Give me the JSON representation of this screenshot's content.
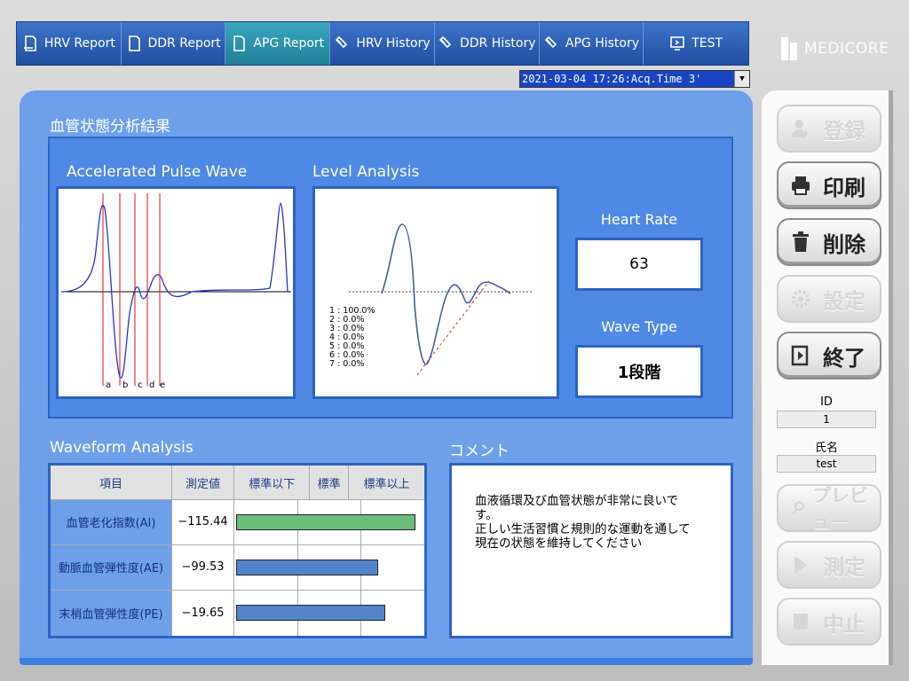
{
  "tabs": [
    {
      "label": "HRV Report",
      "icon": "report-icon"
    },
    {
      "label": "DDR Report",
      "icon": "report-icon"
    },
    {
      "label": "APG Report",
      "icon": "report-icon",
      "active": true
    },
    {
      "label": "HRV History",
      "icon": "history-icon"
    },
    {
      "label": "DDR History",
      "icon": "history-icon"
    },
    {
      "label": "APG History",
      "icon": "history-icon"
    },
    {
      "label": "TEST",
      "icon": "monitor-icon"
    }
  ],
  "brand": "MEDICORE",
  "record_select": {
    "value": "2021-03-04 17:26:Acq.Time   3'"
  },
  "main": {
    "section_title": "血管状態分析結果",
    "apg_title": "Accelerated Pulse Wave",
    "apg_wave_labels": [
      "a",
      "b",
      "c",
      "d",
      "e"
    ],
    "level_title": "Level Analysis",
    "level_list": [
      "1 : 100.0%",
      "2 : 0.0%",
      "3 : 0.0%",
      "4 : 0.0%",
      "5 : 0.0%",
      "6 : 0.0%",
      "7 : 0.0%"
    ],
    "heart_rate": {
      "label": "Heart Rate",
      "value": "63"
    },
    "wave_type": {
      "label": "Wave Type",
      "value": "1段階"
    }
  },
  "waveform": {
    "title": "Waveform Analysis",
    "headers": [
      "項目",
      "測定値",
      "標準以下",
      "標準",
      "標準以上"
    ],
    "rows": [
      {
        "name": "血管老化指数(AI)",
        "value": "−115.44",
        "level": 0.96,
        "color": "#6cbd7c"
      },
      {
        "name": "動脈血管弾性度(AE)",
        "value": "−99.53",
        "level": 0.76,
        "color": "#5384c9"
      },
      {
        "name": "末梢血管弾性度(PE)",
        "value": "−19.65",
        "level": 0.8,
        "color": "#5384c9"
      }
    ]
  },
  "comment": {
    "title": "コメント",
    "text": "血液循環及び血管状態が非常に良いで\nす。\n正しい生活習慣と規則的な運動を通して\n現在の状態を維持してください"
  },
  "sidebar": {
    "buttons": [
      {
        "label": "登録",
        "icon": "add-user-icon",
        "enabled": false
      },
      {
        "label": "印刷",
        "icon": "printer-icon",
        "enabled": true
      },
      {
        "label": "削除",
        "icon": "trash-icon",
        "enabled": true
      },
      {
        "label": "設定",
        "icon": "gear-icon",
        "enabled": false
      },
      {
        "label": "終了",
        "icon": "exit-icon",
        "enabled": true
      }
    ],
    "id_label": "ID",
    "id_value": "1",
    "name_label": "氏名",
    "name_value": "test",
    "lower_buttons": [
      {
        "label": "プレビュー",
        "icon": "search-icon",
        "enabled": false
      },
      {
        "label": "測定",
        "icon": "play-icon",
        "enabled": false
      },
      {
        "label": "中止",
        "icon": "stop-icon",
        "enabled": false
      }
    ]
  }
}
